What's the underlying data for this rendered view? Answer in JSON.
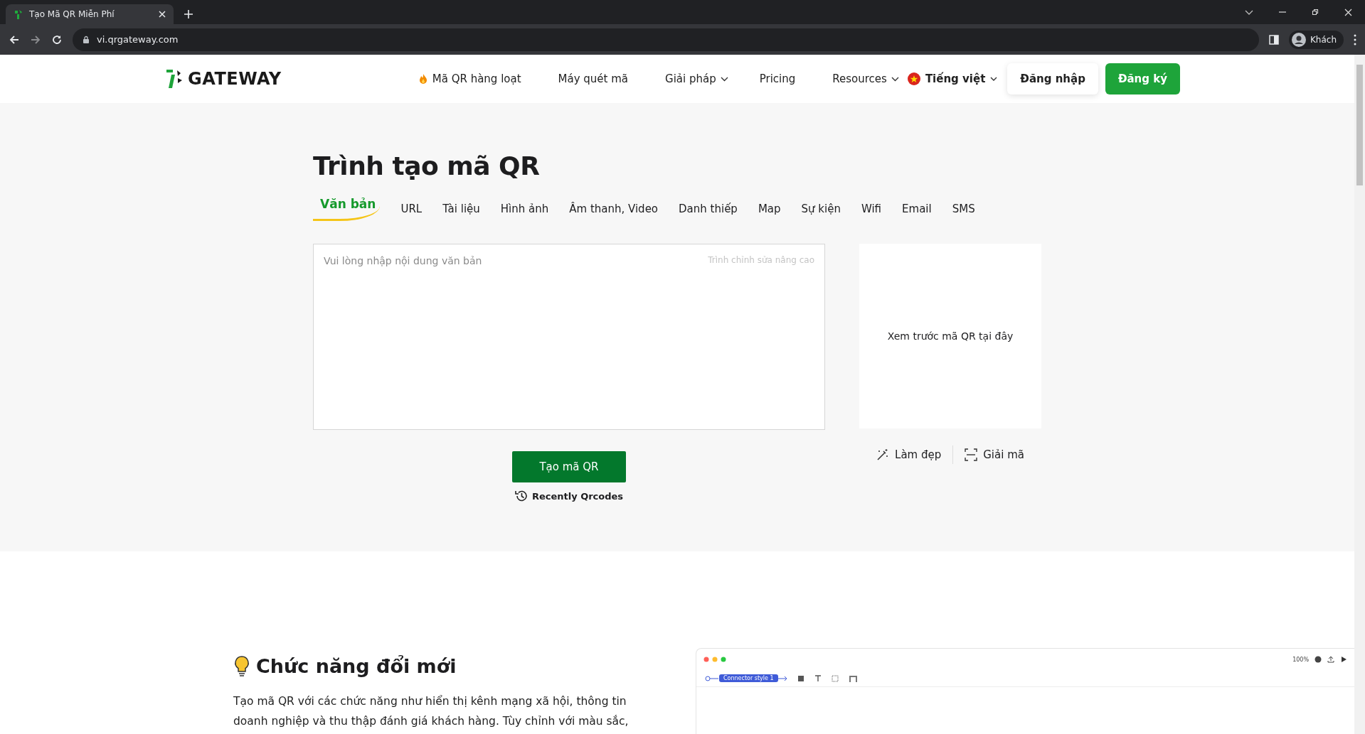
{
  "browser": {
    "tab_title": "Tạo Mã QR Miễn Phí",
    "url": "vi.qrgateway.com",
    "profile": "Khách"
  },
  "nav": {
    "logo": "GATEWAY",
    "items": [
      {
        "label": "Mã QR hàng loạt",
        "kind": "hot"
      },
      {
        "label": "Máy quét mã",
        "kind": "link"
      },
      {
        "label": "Giải pháp",
        "kind": "dropdown"
      },
      {
        "label": "Pricing",
        "kind": "link"
      },
      {
        "label": "Resources",
        "kind": "dropdown"
      }
    ],
    "language": "Tiếng việt",
    "login": "Đăng nhập",
    "signup": "Đăng ký"
  },
  "generator": {
    "title": "Trình tạo mã QR",
    "tabs": [
      {
        "label": "Văn bản",
        "selected": true
      },
      {
        "label": "URL",
        "selected": false
      },
      {
        "label": "Tài liệu",
        "selected": false
      },
      {
        "label": "Hình ảnh",
        "selected": false
      },
      {
        "label": "Âm thanh, Video",
        "selected": false
      },
      {
        "label": "Danh thiếp",
        "selected": false
      },
      {
        "label": "Map",
        "selected": false
      },
      {
        "label": "Sự kiện",
        "selected": false
      },
      {
        "label": "Wifi",
        "selected": false
      },
      {
        "label": "Email",
        "selected": false
      },
      {
        "label": "SMS",
        "selected": false
      }
    ],
    "text_input": {
      "placeholder": "Vui lòng nhập nội dung văn bản",
      "advanced_editor": "Trình chỉnh sửa nâng cao"
    },
    "preview": "Xem trước mã QR tại đây",
    "create_button": "Tạo mã QR",
    "recent": "Recently Qrcodes",
    "actions": [
      {
        "label": "Làm đẹp",
        "kind": "beautify"
      },
      {
        "label": "Giải mã",
        "kind": "decode"
      }
    ]
  },
  "feature": {
    "heading": "Chức năng đổi mới",
    "paragraph": "Tạo mã QR với các chức năng như hiển thị kênh mạng xã hội, thông tin doanh nghiệp và thu thập đánh giá khách hàng. Tùy chỉnh với màu sắc,",
    "demo": {
      "connector": "Connector style 1",
      "zoom": "100%"
    }
  }
}
